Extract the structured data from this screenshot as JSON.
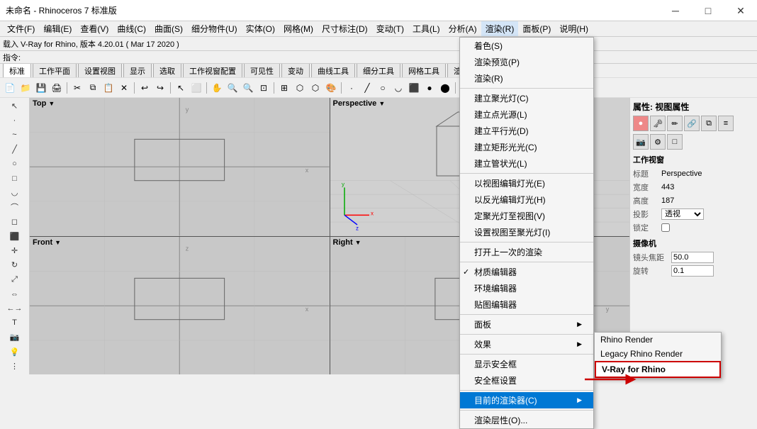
{
  "titleBar": {
    "title": "未命名 - Rhinoceros 7 标准版",
    "minBtn": "─",
    "maxBtn": "□",
    "closeBtn": "✕"
  },
  "menuBar": {
    "items": [
      {
        "label": "文件(F)"
      },
      {
        "label": "编辑(E)"
      },
      {
        "label": "查看(V)"
      },
      {
        "label": "曲线(C)"
      },
      {
        "label": "曲面(S)"
      },
      {
        "label": "细分物件(U)"
      },
      {
        "label": "实体(O)"
      },
      {
        "label": "网格(M)"
      },
      {
        "label": "尺寸标注(D)"
      },
      {
        "label": "变动(T)"
      },
      {
        "label": "工具(L)"
      },
      {
        "label": "分析(A)"
      },
      {
        "label": "渲染(R)",
        "active": true
      },
      {
        "label": "面板(P)"
      },
      {
        "label": "说明(H)"
      }
    ]
  },
  "cmdBar": {
    "loadText": "载入 V-Ray for Rhino, 版本 4.20.01 ( Mar 17 2020 )",
    "promptLabel": "指令:"
  },
  "toolbarTabs": {
    "tabs": [
      "标准",
      "工作平面",
      "设置视图",
      "显示",
      "选取",
      "工作视窗配置",
      "可见性",
      "变动",
      "曲线工具",
      "细分工具",
      "网格工具",
      "渲染"
    ]
  },
  "viewports": [
    {
      "id": "top",
      "label": "Top",
      "active": false
    },
    {
      "id": "perspective",
      "label": "Perspective",
      "active": true
    },
    {
      "id": "front",
      "label": "Front",
      "active": false
    },
    {
      "id": "right",
      "label": "Right",
      "active": false
    }
  ],
  "rightPanel": {
    "title": "属性: 视图属性",
    "sections": {
      "workViewport": {
        "title": "工作视窗",
        "rows": [
          {
            "label": "标题",
            "value": "Perspective"
          },
          {
            "label": "宽度",
            "value": "443"
          },
          {
            "label": "高度",
            "value": "187"
          },
          {
            "label": "投影",
            "value": "透视"
          },
          {
            "label": "锁定",
            "value": ""
          }
        ]
      },
      "camera": {
        "title": "摄像机",
        "rows": [
          {
            "label": "镜头焦距",
            "value": "50.0"
          },
          {
            "label": "旋转",
            "value": "0.1"
          }
        ]
      }
    }
  },
  "renderMenu": {
    "items": [
      {
        "label": "着色(S)",
        "type": "normal"
      },
      {
        "label": "渲染预览(P)",
        "type": "normal"
      },
      {
        "label": "渲染(R)",
        "type": "normal"
      },
      {
        "type": "separator"
      },
      {
        "label": "建立聚光灯(C)",
        "type": "normal"
      },
      {
        "label": "建立点光源(L)",
        "type": "normal"
      },
      {
        "label": "建立平行光(D)",
        "type": "normal"
      },
      {
        "label": "建立矩形光光(C)",
        "type": "normal"
      },
      {
        "label": "建立管状光(L)",
        "type": "normal"
      },
      {
        "type": "separator"
      },
      {
        "label": "以视图编辑灯光(E)",
        "type": "normal"
      },
      {
        "label": "以反光编辑灯光(H)",
        "type": "normal"
      },
      {
        "label": "定聚光灯至视图(V)",
        "type": "normal"
      },
      {
        "label": "设置视图至聚光灯(I)",
        "type": "normal"
      },
      {
        "type": "separator"
      },
      {
        "label": "打开上一次的渲染",
        "type": "normal"
      },
      {
        "type": "separator"
      },
      {
        "label": "材质编辑器",
        "type": "checked"
      },
      {
        "label": "环境编辑器",
        "type": "normal"
      },
      {
        "label": "贴图编辑器",
        "type": "normal"
      },
      {
        "type": "separator"
      },
      {
        "label": "面板",
        "type": "submenu"
      },
      {
        "type": "separator"
      },
      {
        "label": "效果",
        "type": "submenu"
      },
      {
        "type": "separator"
      },
      {
        "label": "显示安全框",
        "type": "normal"
      },
      {
        "label": "安全框设置",
        "type": "normal"
      },
      {
        "type": "separator"
      },
      {
        "label": "目前的渲染器(C)",
        "type": "submenu",
        "highlighted": true
      },
      {
        "type": "separator"
      },
      {
        "label": "渲染层性(O)...",
        "type": "normal"
      }
    ]
  },
  "rendererSubmenu": {
    "items": [
      {
        "label": "Rhino Render",
        "type": "normal"
      },
      {
        "label": "Legacy Rhino Render",
        "type": "normal"
      },
      {
        "label": "V-Ray for Rhino",
        "type": "highlighted",
        "hasDot": true
      }
    ]
  },
  "icons": {
    "circle": "●",
    "square": "■",
    "triangle": "▶",
    "check": "✓",
    "arrow_right": "▶",
    "arrow_down": "▼",
    "camera": "📷",
    "gear": "⚙",
    "paint": "🎨"
  }
}
